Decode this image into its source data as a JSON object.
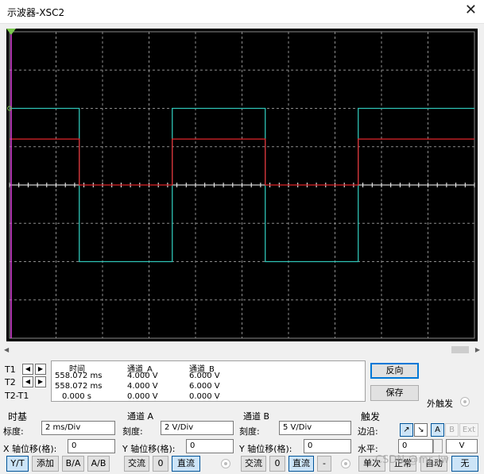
{
  "window": {
    "title": "示波器-XSC2",
    "close_label": "✕"
  },
  "screen": {
    "background": "#000000",
    "grid_color": "#8c8c8c",
    "channel_a_color": "#2ec4b6",
    "channel_b_color": "#e0252b",
    "axis_color": "#ffffff",
    "t1_color": "#e040e0",
    "t2_color": "#7ac74f"
  },
  "chart_data": {
    "type": "line",
    "xlabel": "",
    "ylabel": "",
    "xlim": [
      0,
      20
    ],
    "ylim": [
      -4,
      4
    ],
    "grid": true,
    "series": [
      {
        "x": [
          0,
          3,
          3,
          7,
          7,
          11,
          11,
          15,
          15,
          20
        ],
        "values": [
          2,
          2,
          -2,
          -2,
          2,
          2,
          -2,
          -2,
          2,
          2
        ]
      },
      {
        "x": [
          0,
          3,
          3,
          7,
          7,
          11,
          11,
          15,
          15,
          20
        ],
        "values": [
          1.2,
          1.2,
          0,
          0,
          1.2,
          1.2,
          0,
          0,
          1.2,
          1.2
        ]
      }
    ]
  },
  "readout": {
    "headers": {
      "time": "时间",
      "ch_a": "通道_A",
      "ch_b": "通道_B"
    },
    "rows": [
      {
        "label": "T1",
        "time": "558.072 ms",
        "a": "4.000 V",
        "b": "6.000 V"
      },
      {
        "label": "T2",
        "time": "558.072 ms",
        "a": "4.000 V",
        "b": "6.000 V"
      },
      {
        "label": "T2-T1",
        "time": "0.000 s",
        "a": "0.000 V",
        "b": "0.000 V"
      }
    ],
    "arrow_left": "◀",
    "arrow_right": "▶"
  },
  "buttons": {
    "reverse": "反向",
    "save": "保存",
    "ext_trigger": "外触发"
  },
  "timebase": {
    "title": "时基",
    "scale_label": "标度:",
    "scale_value": "2 ms/Div",
    "xpos_label": "X 轴位移(格):",
    "xpos_value": "0",
    "modes": [
      "Y/T",
      "添加",
      "B/A",
      "A/B"
    ]
  },
  "channel_a": {
    "title": "通道 A",
    "scale_label": "刻度:",
    "scale_value": "2  V/Div",
    "ypos_label": "Y 轴位移(格):",
    "ypos_value": "0",
    "coupling": [
      "交流",
      "0",
      "直流"
    ]
  },
  "channel_b": {
    "title": "通道 B",
    "scale_label": "刻度:",
    "scale_value": "5  V/Div",
    "ypos_label": "Y 轴位移(格):",
    "ypos_value": "0",
    "coupling": [
      "交流",
      "0",
      "直流",
      "-"
    ]
  },
  "trigger": {
    "title": "触发",
    "edge_label": "边沿:",
    "edge_rise": "↗",
    "edge_fall": "↘",
    "sources": [
      "A",
      "B",
      "Ext"
    ],
    "level_label": "水平:",
    "level_value": "0",
    "level_unit": "V",
    "modes": [
      "单次",
      "正常",
      "自动",
      "无"
    ]
  },
  "watermark": "CSDN @mr_lw"
}
